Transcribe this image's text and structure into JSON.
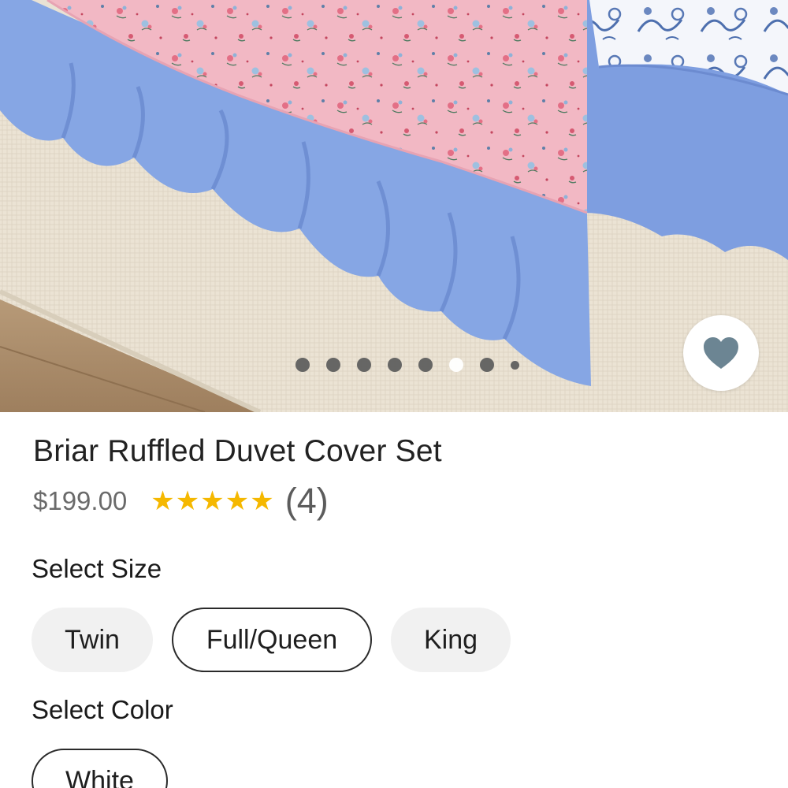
{
  "gallery": {
    "image_alt": "Briar Ruffled Duvet Cover Set product photo",
    "dots": [
      {
        "active": false,
        "small": false
      },
      {
        "active": false,
        "small": false
      },
      {
        "active": false,
        "small": false
      },
      {
        "active": false,
        "small": false
      },
      {
        "active": false,
        "small": false
      },
      {
        "active": true,
        "small": false
      },
      {
        "active": false,
        "small": false
      },
      {
        "active": false,
        "small": true
      }
    ],
    "favorite_icon": "heart-icon",
    "favorite_icon_color": "#6c8593"
  },
  "product": {
    "title": "Briar Ruffled Duvet Cover Set",
    "price": "$199.00",
    "rating": 5,
    "stars": [
      "★",
      "★",
      "★",
      "★",
      "★"
    ],
    "review_count": "(4)",
    "star_color": "#f5b800"
  },
  "size": {
    "label": "Select Size",
    "options": [
      "Twin",
      "Full/Queen",
      "King"
    ],
    "selected": "Full/Queen"
  },
  "color": {
    "label": "Select Color",
    "options": [
      "White"
    ],
    "selected": "White"
  }
}
